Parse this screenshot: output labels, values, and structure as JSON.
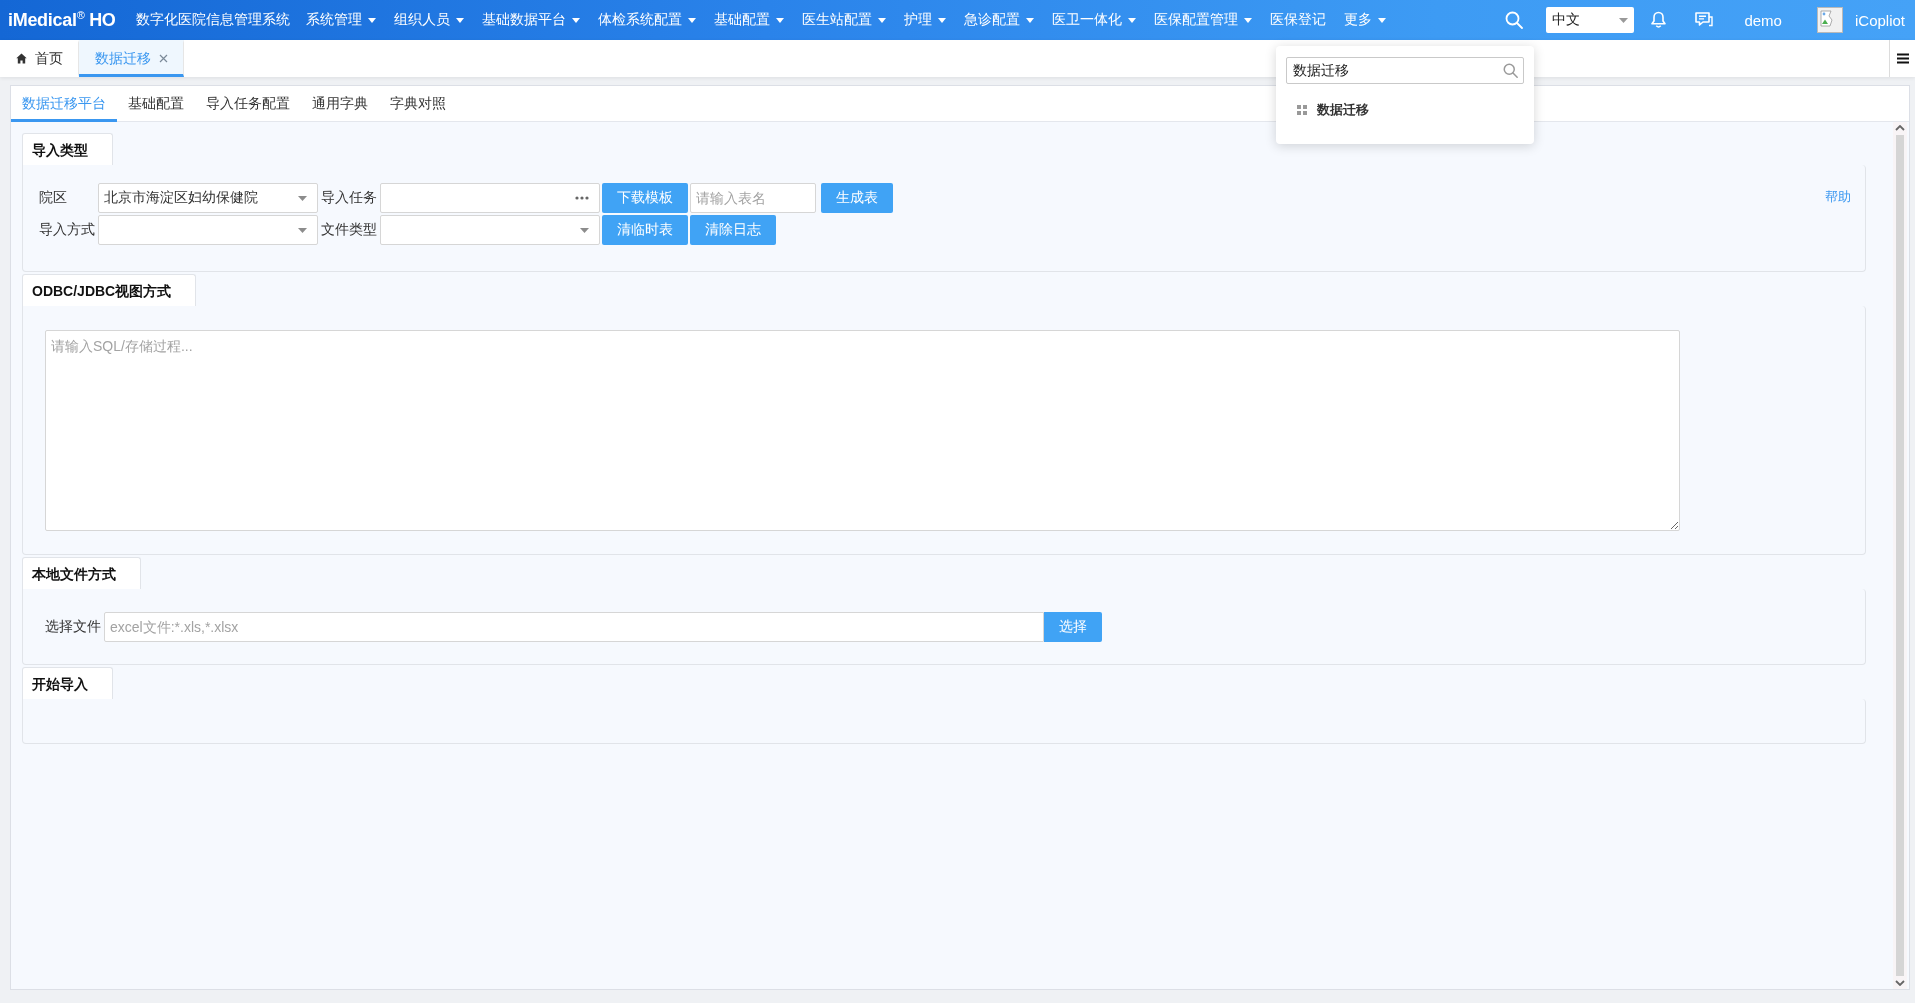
{
  "topbar": {
    "logo": "iMedical$^{®}$ HO",
    "system_title": "数字化医院信息管理系统",
    "menus": [
      {
        "label": "系统管理",
        "has_dropdown": true
      },
      {
        "label": "组织人员",
        "has_dropdown": true
      },
      {
        "label": "基础数据平台",
        "has_dropdown": true
      },
      {
        "label": "体检系统配置",
        "has_dropdown": true
      },
      {
        "label": "基础配置",
        "has_dropdown": true
      },
      {
        "label": "医生站配置",
        "has_dropdown": true
      },
      {
        "label": "护理",
        "has_dropdown": true
      },
      {
        "label": "急诊配置",
        "has_dropdown": true
      },
      {
        "label": "医卫一体化",
        "has_dropdown": true
      },
      {
        "label": "医保配置管理",
        "has_dropdown": true
      },
      {
        "label": "医保登记",
        "has_dropdown": false
      },
      {
        "label": "更多",
        "has_dropdown": true
      }
    ],
    "language": "中文",
    "user": "demo",
    "assistant": "iCopliot"
  },
  "page_tabs": [
    {
      "kind": "home",
      "label": "首页",
      "selected": false,
      "closable": false
    },
    {
      "kind": "page",
      "label": "数据迁移",
      "selected": true,
      "closable": true
    }
  ],
  "menu_search": {
    "value": "数据迁移",
    "results": [
      {
        "label": "数据迁移"
      }
    ]
  },
  "subtabs": [
    {
      "label": "数据迁移平台",
      "selected": true
    },
    {
      "label": "基础配置",
      "selected": false
    },
    {
      "label": "导入任务配置",
      "selected": false
    },
    {
      "label": "通用字典",
      "selected": false
    },
    {
      "label": "字典对照",
      "selected": false
    }
  ],
  "sections": [
    {
      "kind": "form",
      "title": "导入类型",
      "help_link": "帮助",
      "rows": [
        {
          "fields": [
            {
              "kind": "label",
              "text": "院区"
            },
            {
              "kind": "select",
              "value": "北京市海淀区妇幼保健院"
            },
            {
              "kind": "label",
              "text": "导入任务"
            },
            {
              "kind": "picker"
            },
            {
              "kind": "button",
              "text": "下载模板"
            },
            {
              "kind": "input",
              "placeholder": "请输入表名"
            },
            {
              "kind": "button",
              "text": "生成表"
            }
          ]
        },
        {
          "fields": [
            {
              "kind": "label",
              "text": "导入方式"
            },
            {
              "kind": "select"
            },
            {
              "kind": "label",
              "text": "文件类型"
            },
            {
              "kind": "select"
            },
            {
              "kind": "button",
              "text": "清临时表"
            },
            {
              "kind": "button",
              "text": "清除日志"
            }
          ]
        }
      ]
    },
    {
      "kind": "sql",
      "title": "ODBC/JDBC视图方式",
      "placeholder": "请输入SQL/存储过程..."
    },
    {
      "kind": "file",
      "title": "本地文件方式",
      "label": "选择文件",
      "placeholder": "excel文件:*.xls,*.xlsx",
      "button": "选择"
    },
    {
      "kind": "blank",
      "title": "开始导入"
    }
  ]
}
